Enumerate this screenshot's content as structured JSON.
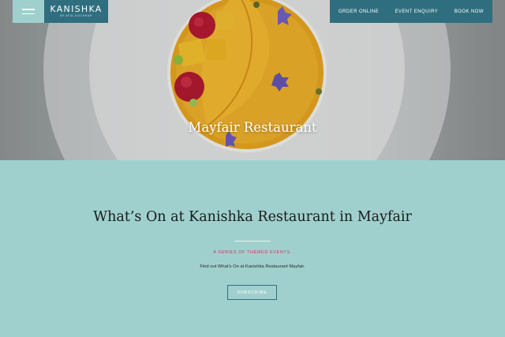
{
  "header": {
    "brand": "KANISHKA",
    "brand_tagline": "BY ATUL KOCHHAR",
    "nav": [
      {
        "label": "ORDER ONLINE"
      },
      {
        "label": "EVENT ENQUIRY"
      },
      {
        "label": "BOOK NOW"
      }
    ]
  },
  "hero": {
    "title": "Mayfair Restaurant"
  },
  "main": {
    "heading": "What’s On at Kanishka Restaurant in Mayfair",
    "kicker": "A SERIES OF THEMED EVENTS.",
    "description": "Find out What’s On at Kanishka Restaurant Mayfair.",
    "cta_label": "SUBSCRIBE"
  },
  "colors": {
    "teal_dark": "#2f6e7f",
    "teal_light": "#9fd0cd",
    "accent_pink": "#c43a6a"
  },
  "icons": {
    "menu": "hamburger-icon"
  }
}
